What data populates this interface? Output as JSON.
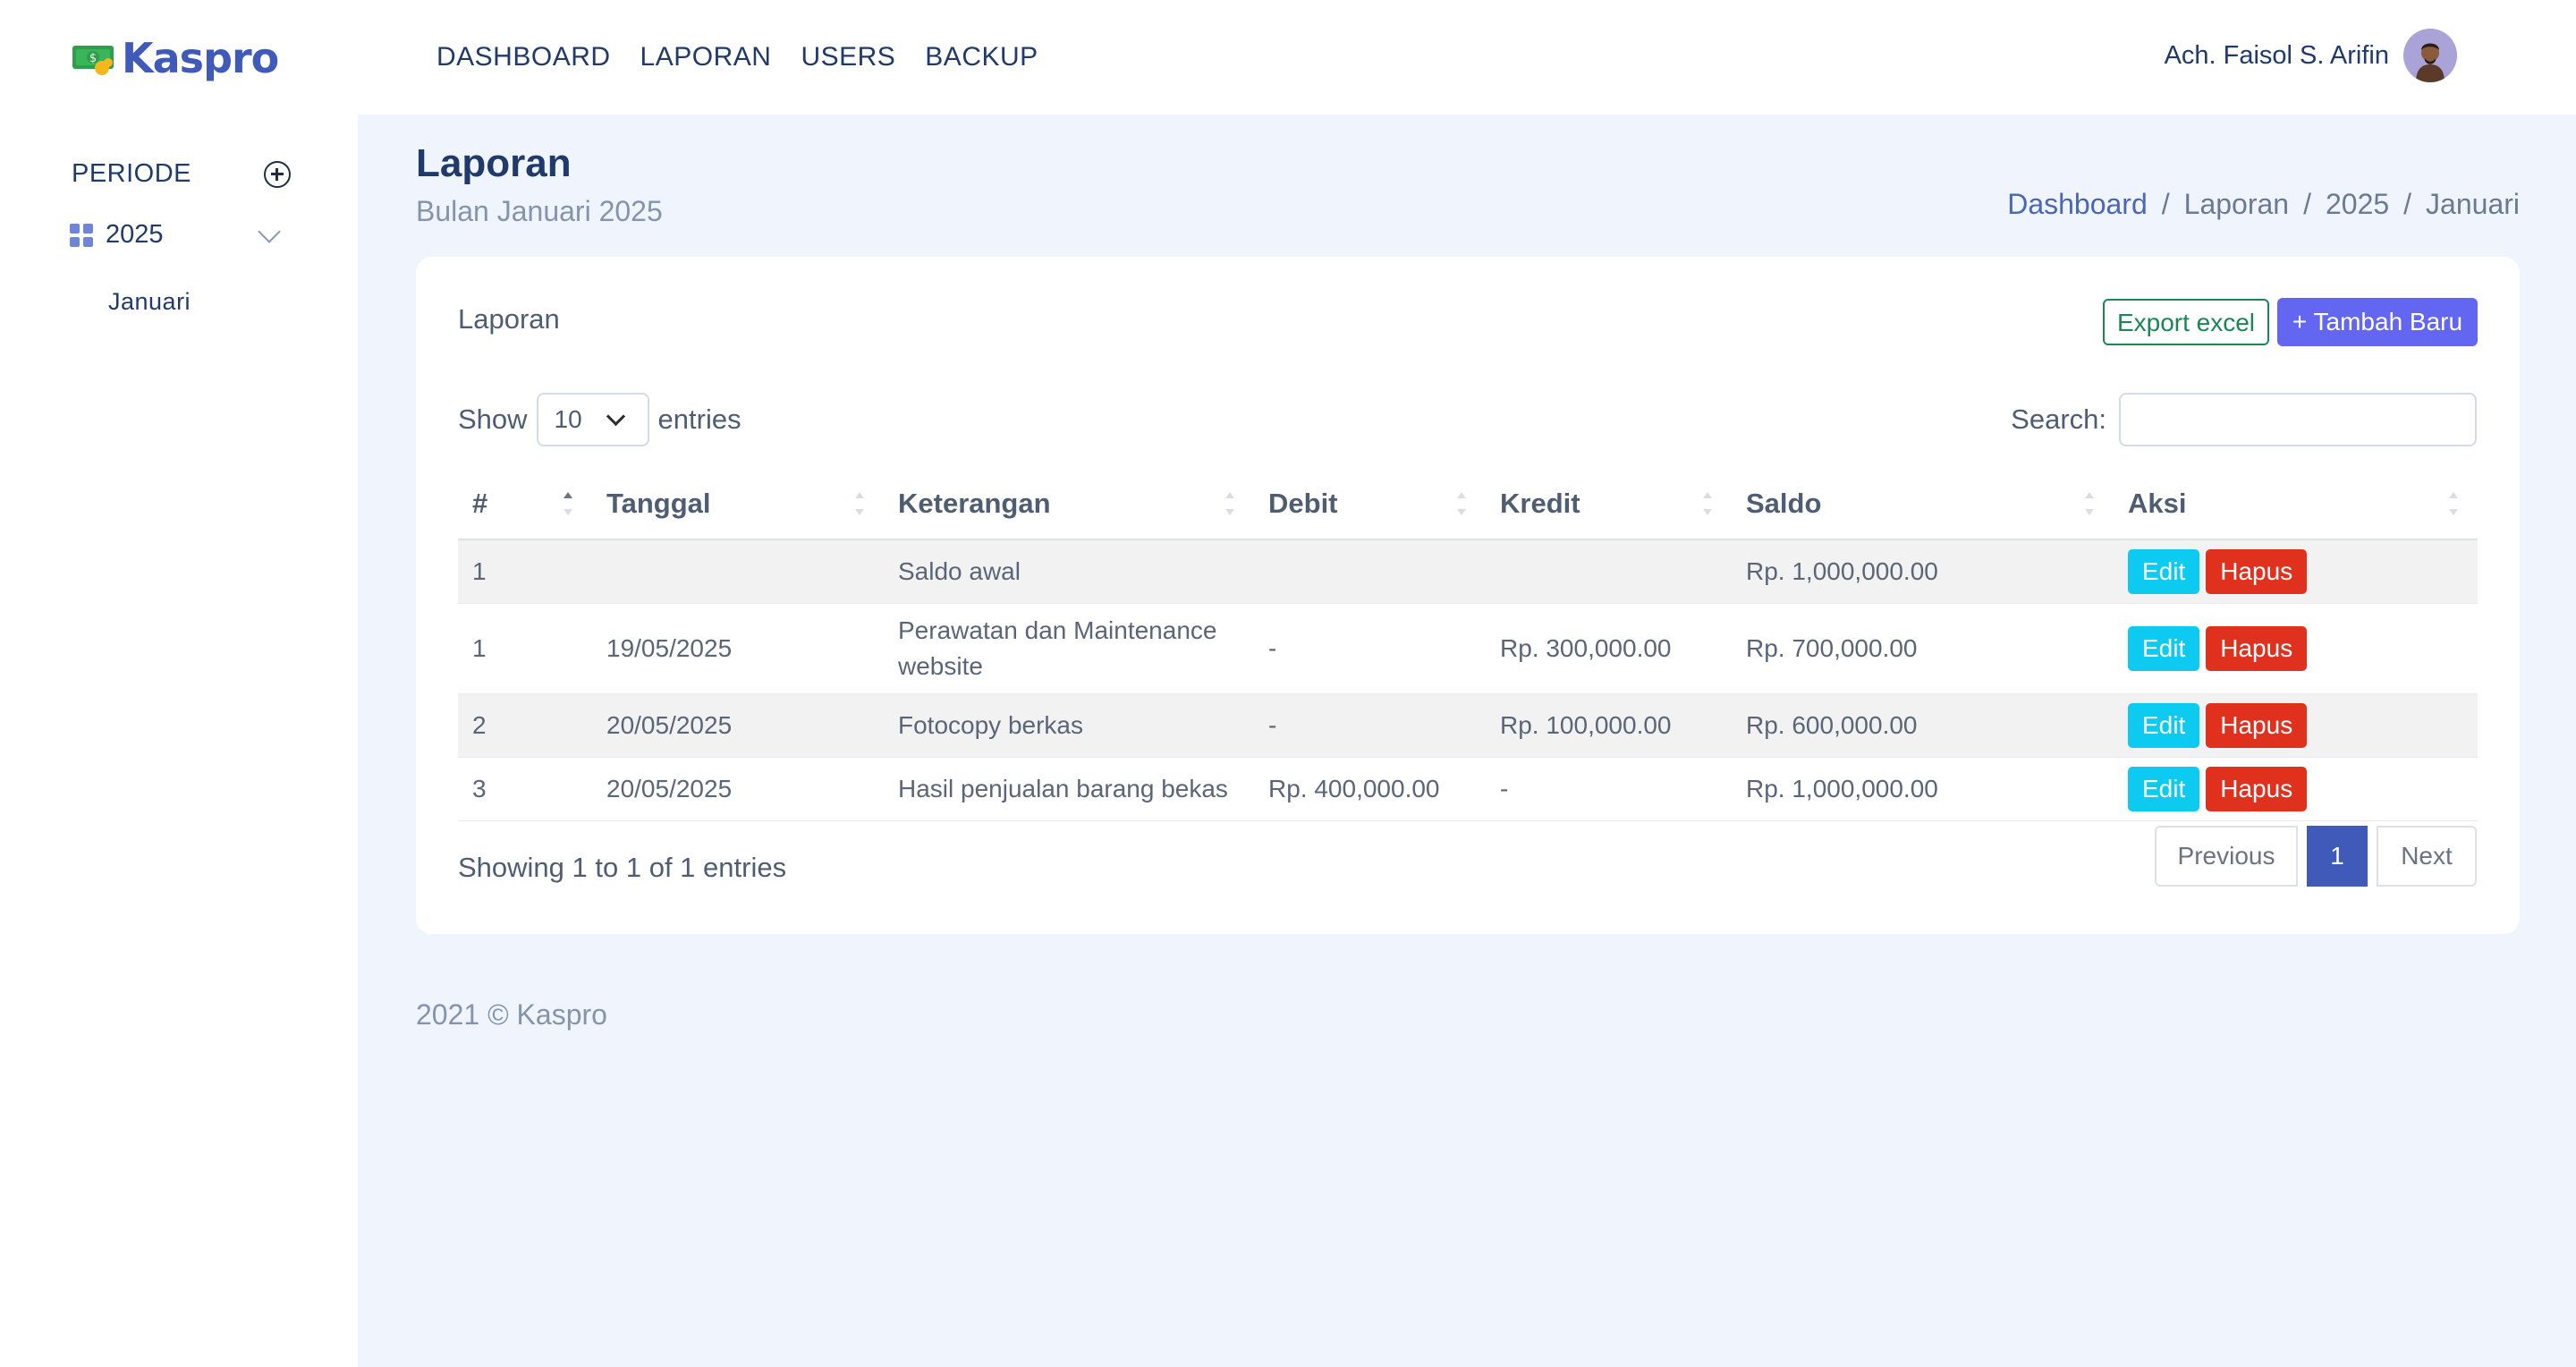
{
  "app": {
    "name": "Kaspro"
  },
  "nav": [
    {
      "label": "DASHBOARD"
    },
    {
      "label": "LAPORAN"
    },
    {
      "label": "USERS"
    },
    {
      "label": "BACKUP"
    }
  ],
  "user": {
    "name": "Ach. Faisol S. Arifin"
  },
  "sidebar": {
    "periode_label": "PERIODE",
    "year": "2025",
    "months": [
      "Januari"
    ]
  },
  "page": {
    "title": "Laporan",
    "subtitle": "Bulan Januari 2025",
    "breadcrumb": [
      "Dashboard",
      "Laporan",
      "2025",
      "Januari"
    ]
  },
  "card": {
    "title": "Laporan",
    "export_label": "Export excel",
    "add_label": "+ Tambah Baru"
  },
  "table_controls": {
    "show_label": "Show",
    "entries_label": "entries",
    "page_length": "10",
    "search_label": "Search:",
    "search_value": ""
  },
  "table": {
    "columns": [
      "#",
      "Tanggal",
      "Keterangan",
      "Debit",
      "Kredit",
      "Saldo",
      "Aksi"
    ],
    "rows": [
      {
        "no": "1",
        "tanggal": "",
        "keterangan": "Saldo awal",
        "debit": "",
        "kredit": "",
        "saldo": "Rp. 1,000,000.00"
      },
      {
        "no": "1",
        "tanggal": "19/05/2025",
        "keterangan": "Perawatan dan Maintenance website",
        "debit": "-",
        "kredit": "Rp. 300,000.00",
        "saldo": "Rp. 700,000.00"
      },
      {
        "no": "2",
        "tanggal": "20/05/2025",
        "keterangan": "Fotocopy berkas",
        "debit": "-",
        "kredit": "Rp. 100,000.00",
        "saldo": "Rp. 600,000.00"
      },
      {
        "no": "3",
        "tanggal": "20/05/2025",
        "keterangan": "Hasil penjualan barang bekas",
        "debit": "Rp. 400,000.00",
        "kredit": "-",
        "saldo": "Rp. 1,000,000.00"
      }
    ],
    "edit_label": "Edit",
    "delete_label": "Hapus"
  },
  "pagination": {
    "info": "Showing 1 to 1 of 1 entries",
    "previous": "Previous",
    "current": "1",
    "next": "Next"
  },
  "footer": {
    "text": "2021 © Kaspro"
  },
  "colors": {
    "brand": "#3f5ab8",
    "primary_button": "#6366f1",
    "export_border": "#198754",
    "edit": "#0dcaf0",
    "delete": "#e0301e",
    "background": "#f0f5fd"
  }
}
